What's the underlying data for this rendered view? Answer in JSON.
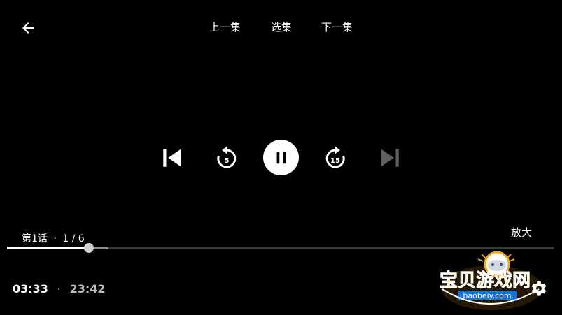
{
  "header": {
    "back_icon": "arrow-left-icon",
    "prev_episode": "上一集",
    "select_episode": "选集",
    "next_episode": "下一集"
  },
  "controls": {
    "skip_previous_icon": "skip-previous-icon",
    "rewind_seconds": "5",
    "pause_icon": "pause-icon",
    "forward_seconds": "15",
    "skip_next_icon": "skip-next-icon"
  },
  "episode": {
    "title": "第1话",
    "separator": "·",
    "index": "1 / 6"
  },
  "zoom_label": "放大",
  "progress": {
    "played_fraction": 0.15,
    "buffered_fraction": 0.185
  },
  "time": {
    "current": "03:33",
    "separator": "·",
    "total": "23:42"
  },
  "settings_icon": "gear-icon",
  "watermark": {
    "text": "宝贝游戏网",
    "url": "baobeiy.com"
  },
  "colors": {
    "background": "#000000",
    "foreground": "#ffffff",
    "disabled": "#5f5f5f",
    "watermark_orange": "#f5a623",
    "watermark_blue": "#1e6fd8"
  }
}
